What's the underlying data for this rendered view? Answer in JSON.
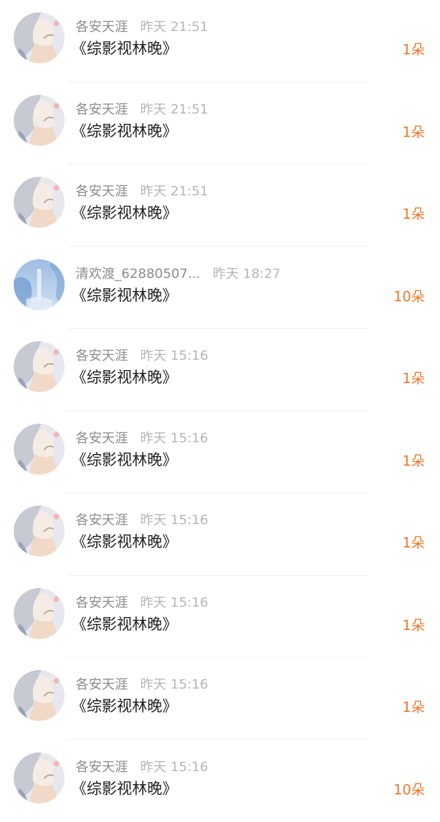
{
  "rows": [
    {
      "name": "各安天涯",
      "time": "昨天 21:51",
      "title": "《综影视林晚》",
      "count": "1朵",
      "avatar": "girl-illustration-icon"
    },
    {
      "name": "各安天涯",
      "time": "昨天 21:51",
      "title": "《综影视林晚》",
      "count": "1朵",
      "avatar": "girl-illustration-icon"
    },
    {
      "name": "各安天涯",
      "time": "昨天 21:51",
      "title": "《综影视林晚》",
      "count": "1朵",
      "avatar": "girl-illustration-icon"
    },
    {
      "name": "清欢渡_62880507...",
      "time": "昨天 18:27",
      "title": "《综影视林晚》",
      "count": "10朵",
      "avatar": "blue-waterfall-icon"
    },
    {
      "name": "各安天涯",
      "time": "昨天 15:16",
      "title": "《综影视林晚》",
      "count": "1朵",
      "avatar": "girl-illustration-icon"
    },
    {
      "name": "各安天涯",
      "time": "昨天 15:16",
      "title": "《综影视林晚》",
      "count": "1朵",
      "avatar": "girl-illustration-icon"
    },
    {
      "name": "各安天涯",
      "time": "昨天 15:16",
      "title": "《综影视林晚》",
      "count": "1朵",
      "avatar": "girl-illustration-icon"
    },
    {
      "name": "各安天涯",
      "time": "昨天 15:16",
      "title": "《综影视林晚》",
      "count": "1朵",
      "avatar": "girl-illustration-icon"
    },
    {
      "name": "各安天涯",
      "time": "昨天 15:16",
      "title": "《综影视林晚》",
      "count": "1朵",
      "avatar": "girl-illustration-icon"
    },
    {
      "name": "各安天涯",
      "time": "昨天 15:16",
      "title": "《综影视林晚》",
      "count": "10朵",
      "avatar": "girl-illustration-icon"
    }
  ],
  "colors": {
    "count": "#f0762a",
    "title": "#222222",
    "name": "#8c8c8c",
    "time": "#b5b5b5",
    "divider": "#efefef"
  }
}
